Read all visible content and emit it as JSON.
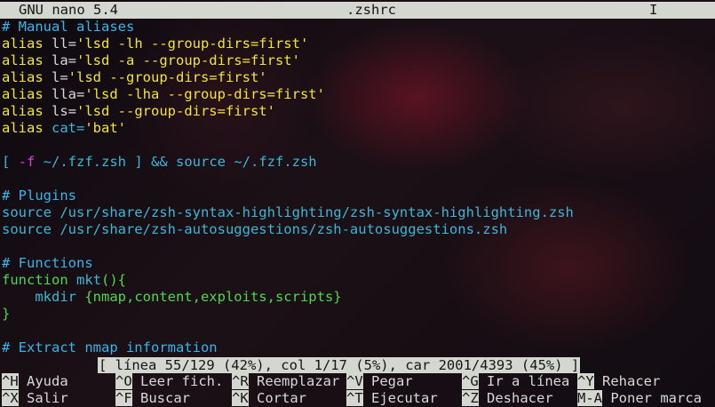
{
  "titlebar": {
    "app": "GNU nano 5.4",
    "filename": ".zshrc",
    "cursor_mark": "I"
  },
  "editor": {
    "lines": [
      [
        {
          "t": "# Manual aliases",
          "c": "comment"
        }
      ],
      [
        {
          "t": "alias ",
          "c": "kw"
        },
        {
          "t": "ll=",
          "c": "white"
        },
        {
          "t": "'lsd -lh --group-dirs=first'",
          "c": "str"
        }
      ],
      [
        {
          "t": "alias ",
          "c": "kw"
        },
        {
          "t": "la=",
          "c": "white"
        },
        {
          "t": "'lsd -a --group-dirs=first'",
          "c": "str"
        }
      ],
      [
        {
          "t": "alias ",
          "c": "kw"
        },
        {
          "t": "l=",
          "c": "white"
        },
        {
          "t": "'lsd --group-dirs=first'",
          "c": "str"
        }
      ],
      [
        {
          "t": "alias ",
          "c": "kw"
        },
        {
          "t": "lla=",
          "c": "white"
        },
        {
          "t": "'lsd -lha --group-dirs=first'",
          "c": "str"
        }
      ],
      [
        {
          "t": "alias ",
          "c": "kw"
        },
        {
          "t": "ls=",
          "c": "white"
        },
        {
          "t": "'lsd --group-dirs=first'",
          "c": "str"
        }
      ],
      [
        {
          "t": "alias ",
          "c": "kw"
        },
        {
          "t": "cat=",
          "c": "cyan"
        },
        {
          "t": "'bat'",
          "c": "str"
        }
      ],
      [],
      [
        {
          "t": "[ ",
          "c": "cyan"
        },
        {
          "t": "-f",
          "c": "magenta"
        },
        {
          "t": " ~/.fzf.zsh ] ",
          "c": "cyan"
        },
        {
          "t": "&&",
          "c": "cyan"
        },
        {
          "t": " source ~/.fzf.zsh",
          "c": "cyan"
        }
      ],
      [],
      [
        {
          "t": "# Plugins",
          "c": "comment"
        }
      ],
      [
        {
          "t": "source /usr/share/zsh-syntax-highlighting/zsh-syntax-highlighting.zsh",
          "c": "cyan"
        }
      ],
      [
        {
          "t": "source /usr/share/zsh-autosuggestions/zsh-autosuggestions.zsh",
          "c": "cyan"
        }
      ],
      [],
      [
        {
          "t": "# Functions",
          "c": "comment"
        }
      ],
      [
        {
          "t": "function ",
          "c": "green"
        },
        {
          "t": "mkt",
          "c": "cyan"
        },
        {
          "t": "(){",
          "c": "green"
        }
      ],
      [
        {
          "t": "    mkdir ",
          "c": "cyan"
        },
        {
          "t": "{nmap,content,exploits,scripts}",
          "c": "green"
        }
      ],
      [
        {
          "t": "}",
          "c": "green"
        }
      ],
      [],
      [
        {
          "t": "# Extract nmap information",
          "c": "comment"
        }
      ]
    ]
  },
  "status": {
    "text": "[ línea 55/129 (42%), col 1/17 (5%), car 2001/4393 (45%) ]"
  },
  "shortcuts": {
    "row1": [
      {
        "key": "^H",
        "label": " Ayuda"
      },
      {
        "key": "^O",
        "label": " Leer fich."
      },
      {
        "key": "^R",
        "label": " Reemplazar"
      },
      {
        "key": "^V",
        "label": " Pegar"
      },
      {
        "key": "^G",
        "label": " Ir a línea"
      },
      {
        "key": "^Y",
        "label": " Rehacer"
      }
    ],
    "row2": [
      {
        "key": "^X",
        "label": " Salir"
      },
      {
        "key": "^F",
        "label": " Buscar"
      },
      {
        "key": "^K",
        "label": " Cortar"
      },
      {
        "key": "^T",
        "label": " Ejecutar"
      },
      {
        "key": "^Z",
        "label": " Deshacer"
      },
      {
        "key": "M-A",
        "label": " Poner marca"
      }
    ]
  },
  "colors": {
    "comment": "#34b6ea",
    "keyword": "#f2e530",
    "string": "#f2e530",
    "cyan": "#3ab8d8",
    "green": "#4fd84b",
    "magenta": "#e040e0",
    "bar_bg": "#d3d7cf"
  }
}
